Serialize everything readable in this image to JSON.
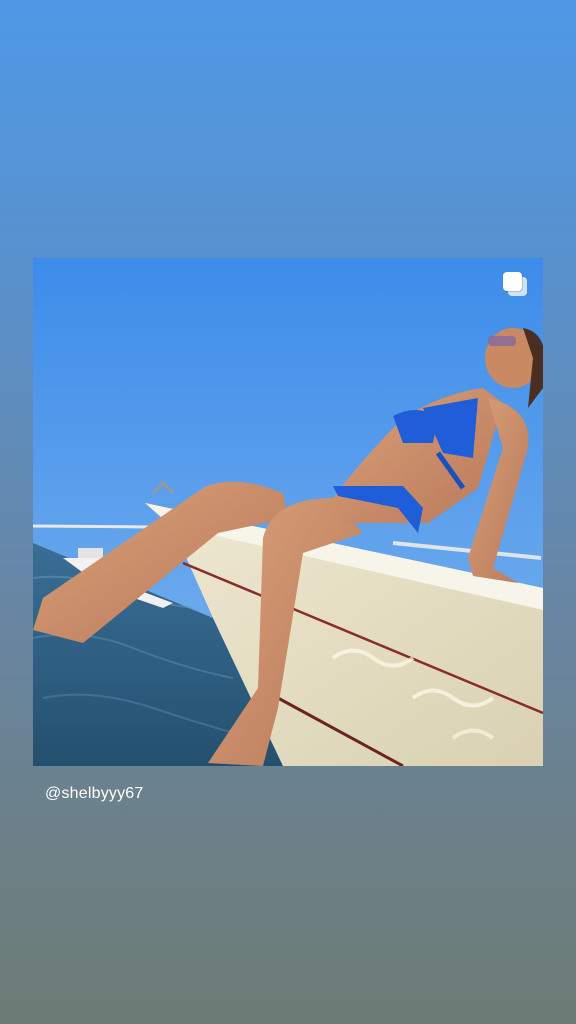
{
  "story": {
    "post": {
      "username": "@shelbyyy67",
      "image_icon": "carousel-icon"
    }
  },
  "colors": {
    "background_top": "#4f98e6",
    "background_bottom": "#6d7c75",
    "sky": "#3f8ee8",
    "water": "#2e5f86",
    "swimsuit": "#1f5ed8",
    "hull": "#e8e2c8"
  }
}
